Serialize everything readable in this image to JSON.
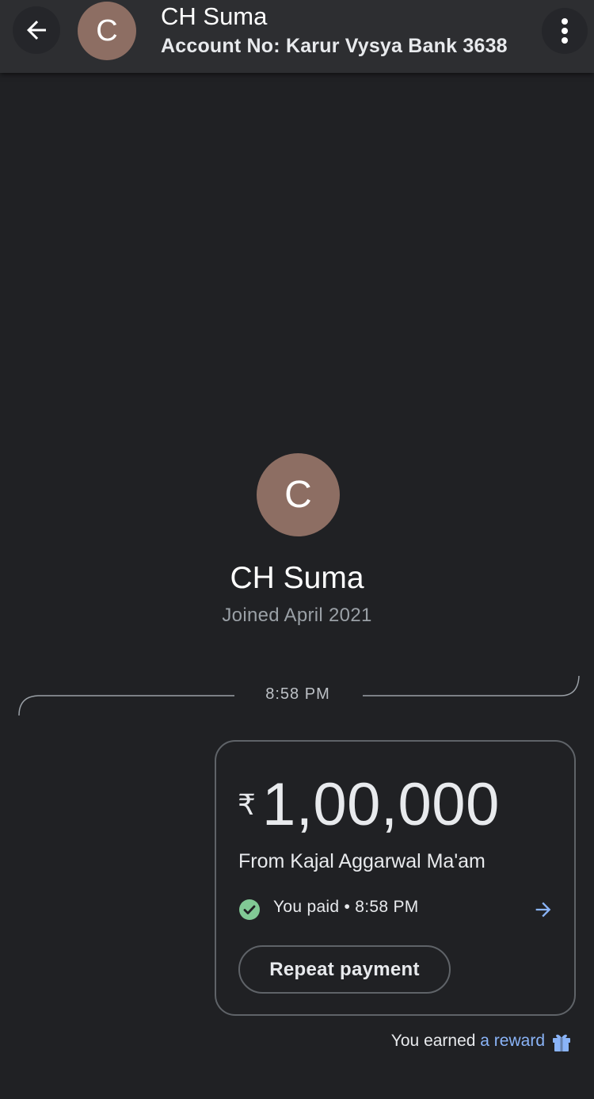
{
  "header": {
    "avatar_initial": "C",
    "title": "CH Suma",
    "subtitle": "Account No: Karur Vysya Bank 3638"
  },
  "profile": {
    "avatar_initial": "C",
    "name": "CH Suma",
    "joined": "Joined April 2021"
  },
  "timeline": {
    "time": "8:58 PM"
  },
  "payment": {
    "currency_symbol": "₹",
    "amount": "1,00,000",
    "from": "From Kajal Aggarwal Ma'am",
    "status": "You paid • 8:58 PM",
    "repeat_label": "Repeat payment"
  },
  "reward": {
    "prefix": "You earned ",
    "link": "a reward"
  },
  "colors": {
    "background": "#202124",
    "appbar": "#2d2e31",
    "avatar": "#8d6e63",
    "success": "#81c995",
    "link": "#8ab4f8"
  },
  "icons": {
    "back": "arrow-back-icon",
    "more": "more-vert-icon",
    "check": "check-circle-icon",
    "arrow": "arrow-forward-icon",
    "gift": "gift-icon"
  }
}
